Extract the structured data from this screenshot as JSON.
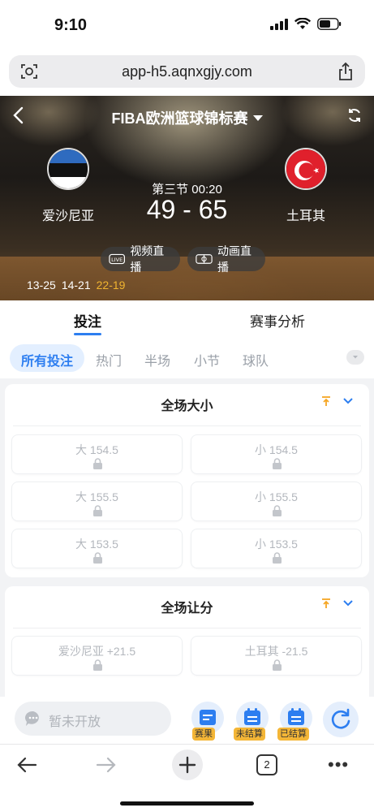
{
  "status_bar": {
    "time": "9:10"
  },
  "browser": {
    "url": "app-h5.aqnxgjy.com",
    "tab_count": "2"
  },
  "header": {
    "league_title": "FIBA欧洲篮球锦标赛",
    "period": "第三节  00:20",
    "score": "49 - 65",
    "home_team": "爱沙尼亚",
    "away_team": "土耳其",
    "live_video_label": "视频直播",
    "live_anim_label": "动画直播",
    "quarters": [
      "13-25",
      "14-21",
      "22-19"
    ]
  },
  "main_tabs": [
    {
      "label": "投注",
      "active": true
    },
    {
      "label": "赛事分析",
      "active": false
    }
  ],
  "sub_tabs": [
    {
      "label": "所有投注",
      "active": true
    },
    {
      "label": "热门"
    },
    {
      "label": "半场"
    },
    {
      "label": "小节"
    },
    {
      "label": "球队"
    }
  ],
  "markets": [
    {
      "title": "全场大小",
      "rows": [
        [
          "大 154.5",
          "小 154.5"
        ],
        [
          "大 155.5",
          "小 155.5"
        ],
        [
          "大 153.5",
          "小 153.5"
        ]
      ]
    },
    {
      "title": "全场让分",
      "rows": [
        [
          "爱沙尼亚 +21.5",
          "土耳其 -21.5"
        ]
      ]
    }
  ],
  "action_bar": {
    "chat_placeholder": "暂未开放",
    "buttons": [
      "赛果",
      "未结算",
      "已结算"
    ]
  },
  "colors": {
    "accent": "#2d7ef0",
    "highlight_quarter": "#f0b430",
    "tag_bg": "#f4b637",
    "pin_orange": "#f5a623"
  },
  "icons": {
    "live_video": "live-icon",
    "live_anim": "animation-icon",
    "lock": "lock-icon",
    "refresh": "refresh-icon"
  }
}
